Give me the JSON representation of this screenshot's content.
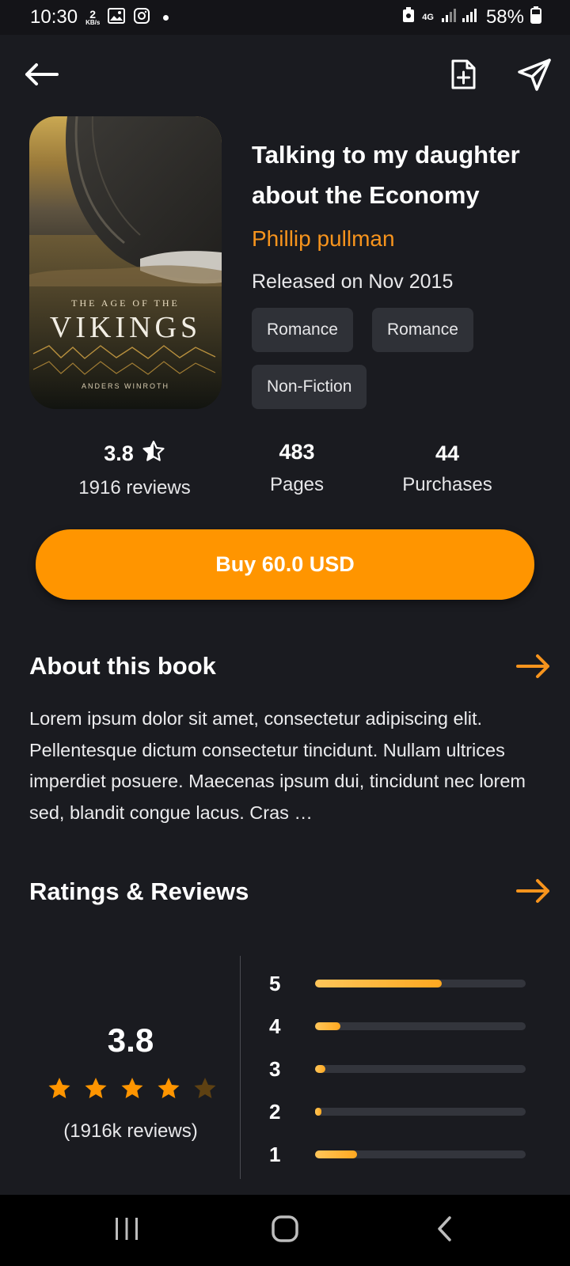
{
  "status_bar": {
    "time": "10:30",
    "net_speed_value": "2",
    "net_speed_unit": "KB/s",
    "network": "4G",
    "battery": "58%"
  },
  "book": {
    "title": "Talking to my daughter about the Economy",
    "author": "Phillip pullman",
    "release": "Released on Nov 2015",
    "tags": [
      "Romance",
      "Romance",
      "Non-Fiction"
    ],
    "cover": {
      "title_small": "THE AGE OF THE",
      "title_big": "VIKINGS",
      "author": "ANDERS WINROTH"
    }
  },
  "stats": {
    "rating": "3.8",
    "reviews_label": "1916 reviews",
    "pages_value": "483",
    "pages_label": "Pages",
    "purchases_value": "44",
    "purchases_label": "Purchases"
  },
  "buy_button": {
    "label": "Buy 60.0 USD"
  },
  "about": {
    "title": "About this book",
    "text": "Lorem ipsum dolor sit amet, consectetur adipiscing elit. Pellentesque dictum consectetur tincidunt. Nullam ultrices imperdiet posuere. Maecenas ipsum dui, tincidunt nec lorem sed, blandit congue lacus. Cras …"
  },
  "ratings_reviews": {
    "title": "Ratings & Reviews",
    "average": "3.8",
    "stars_filled": 4,
    "stars_total": 5,
    "reviews_count": "(1916k reviews)",
    "distribution": [
      {
        "stars": "5",
        "fraction": 0.6
      },
      {
        "stars": "4",
        "fraction": 0.12
      },
      {
        "stars": "3",
        "fraction": 0.05
      },
      {
        "stars": "2",
        "fraction": 0.03
      },
      {
        "stars": "1",
        "fraction": 0.2
      }
    ]
  },
  "colors": {
    "accent": "#ff9500",
    "background": "#1a1b20",
    "chip": "#2f3137"
  },
  "icons": {
    "back": "arrow-left-icon",
    "add_file": "file-plus-icon",
    "share": "send-icon",
    "section_arrow": "arrow-right-icon",
    "star_half": "star-half-icon",
    "star": "star-icon"
  }
}
